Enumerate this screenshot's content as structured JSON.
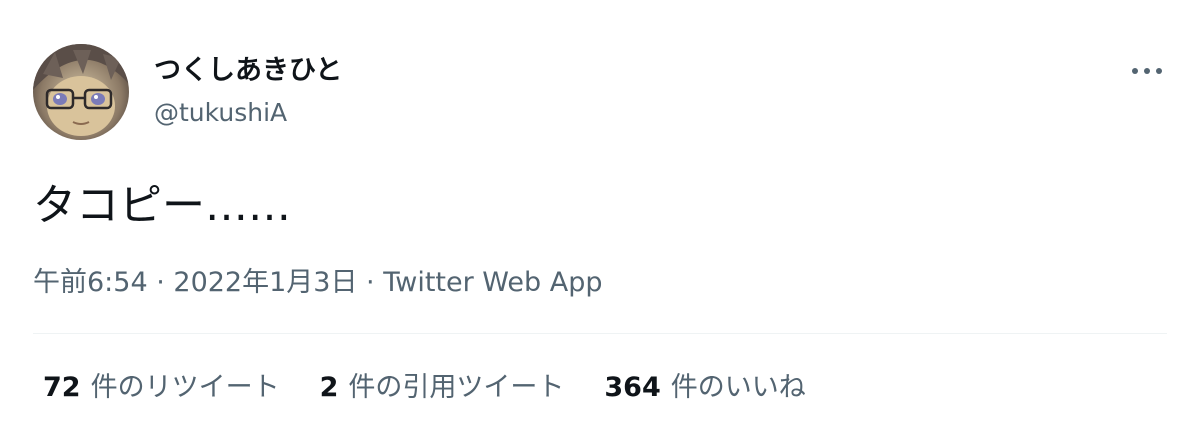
{
  "author": {
    "display_name": "つくしあきひと",
    "handle": "@tukushiA",
    "avatar_icon": "avatar-image"
  },
  "more_icon": "more-horizontal-icon",
  "tweet": {
    "text": "タコピー……",
    "time": "午前6:54",
    "date": "2022年1月3日",
    "source": "Twitter Web App",
    "separator": " · "
  },
  "stats": {
    "retweets": {
      "count": "72",
      "label": "件のリツイート"
    },
    "quotes": {
      "count": "2",
      "label": "件の引用ツイート"
    },
    "likes": {
      "count": "364",
      "label": "件のいいね"
    }
  },
  "colors": {
    "primary_text": "#0f1419",
    "secondary_text": "#536471",
    "divider": "#eff3f4"
  }
}
